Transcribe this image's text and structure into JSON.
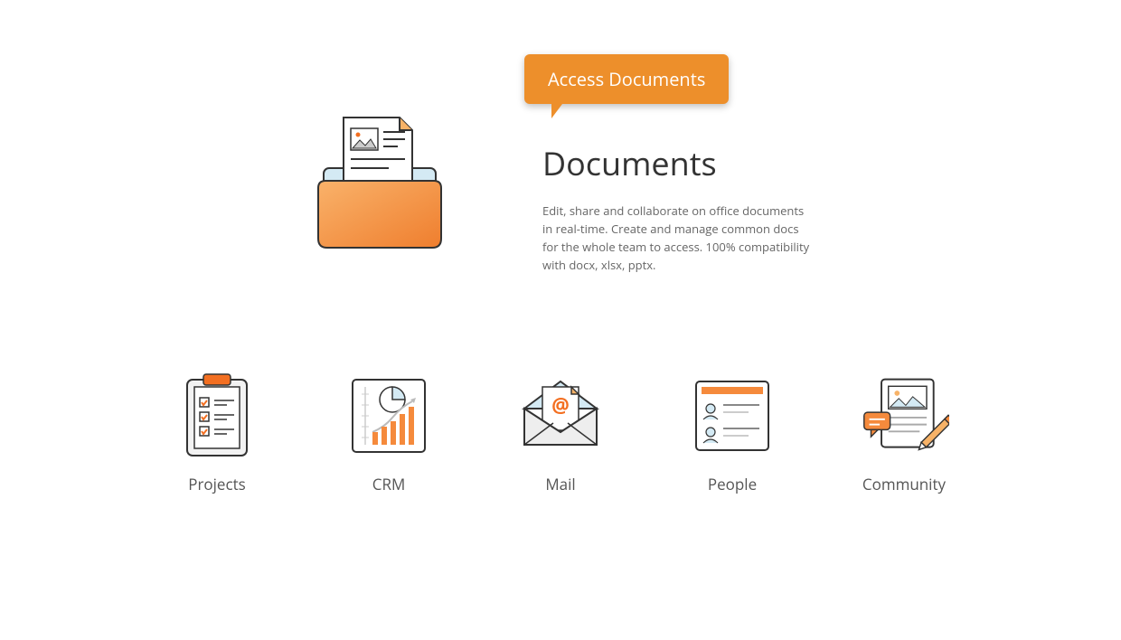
{
  "hero": {
    "callout": "Access Documents",
    "title": "Documents",
    "description": "Edit, share and collaborate on office documents in real-time. Create and manage common docs for the whole team to access. 100% compatibility with docx, xlsx, pptx."
  },
  "modules": [
    {
      "label": "Projects"
    },
    {
      "label": "CRM"
    },
    {
      "label": "Mail"
    },
    {
      "label": "People"
    },
    {
      "label": "Community"
    }
  ]
}
